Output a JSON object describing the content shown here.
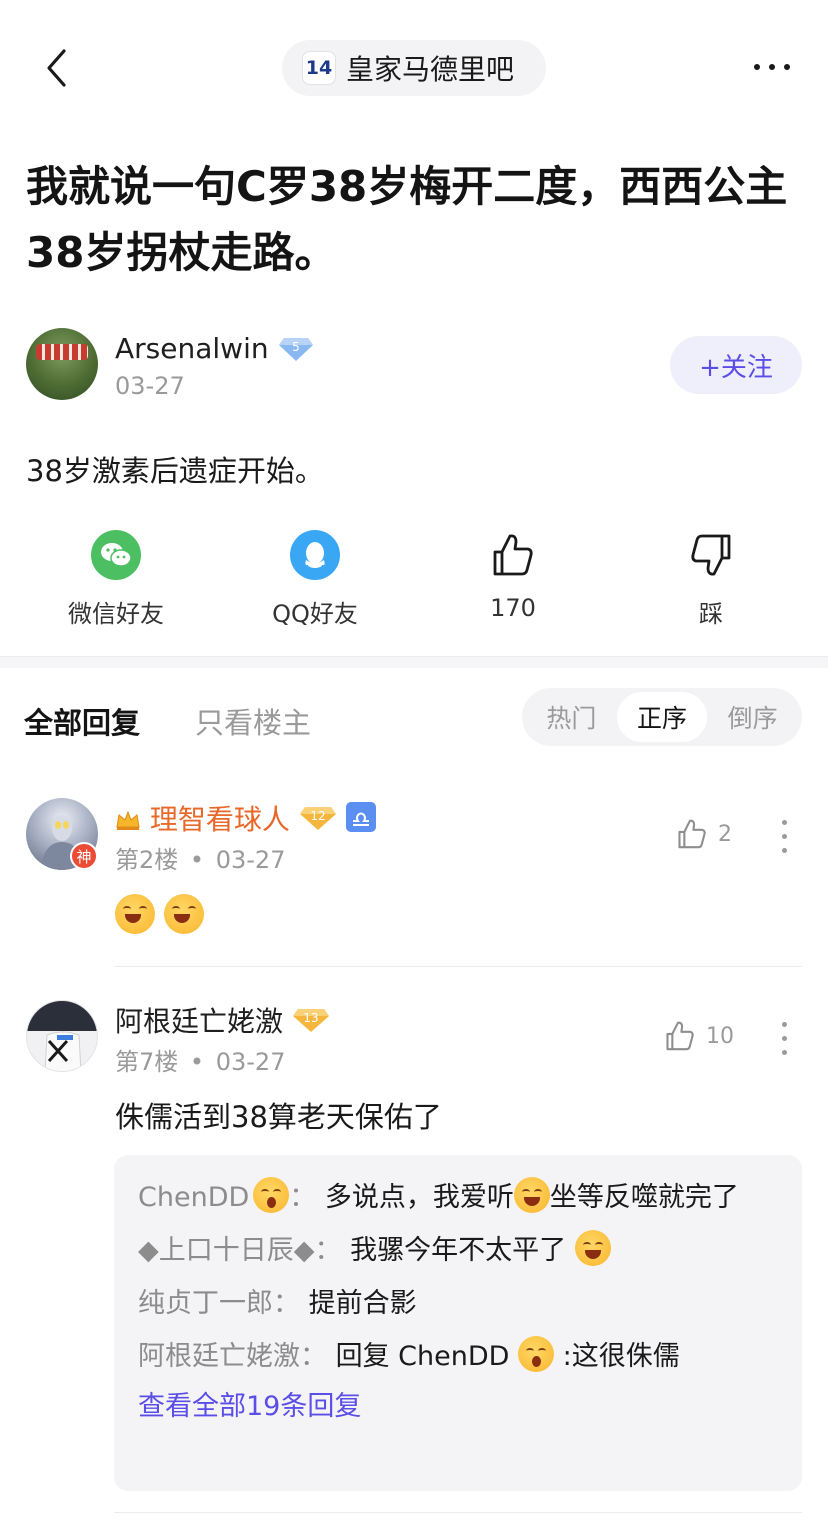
{
  "nav": {
    "forum_logo_text": "14",
    "forum_name": "皇家马德里吧"
  },
  "post": {
    "title": "我就说一句C罗38岁梅开二度，西西公主38岁拐杖走路。",
    "author": {
      "name": "Arsenalwin",
      "level": "5",
      "date": "03-27"
    },
    "follow_label": "+关注",
    "body": "38岁激素后遗症开始。"
  },
  "share": {
    "wechat": "微信好友",
    "qq": "QQ好友",
    "likes": "170",
    "dislike": "踩"
  },
  "tabs": {
    "all": "全部回复",
    "owner_only": "只看楼主"
  },
  "sort": [
    "热门",
    "正序",
    "倒序"
  ],
  "sort_active": "正序",
  "replies": [
    {
      "name": "理智看球人",
      "level": "12",
      "badge": "神",
      "floor": "第2楼",
      "date": "03-27",
      "likes": "2",
      "content": ""
    },
    {
      "name": "阿根廷亡姥激",
      "level": "13",
      "floor": "第7楼",
      "date": "03-27",
      "likes": "10",
      "content": "侏儒活到38算老天保佑了",
      "sub_replies": [
        {
          "user": "ChenDD",
          "sep": "：",
          "text_a": "多说点，我爱听",
          "text_b": "坐等反噬就完了"
        },
        {
          "user": "◆上口十日辰◆",
          "sep": "：",
          "text": "我骡今年不太平了"
        },
        {
          "user": "纯贞丁一郎",
          "sep": "：",
          "text": "提前合影"
        },
        {
          "user": "阿根廷亡姥激",
          "sep": "：",
          "text_a": "回复 ChenDD",
          "text_b": ":这很侏儒"
        }
      ],
      "view_all": "查看全部19条回复"
    }
  ],
  "colors": {
    "accent": "#5b4ee6",
    "vip_name": "#e8682a",
    "muted": "#9a9a9a"
  }
}
